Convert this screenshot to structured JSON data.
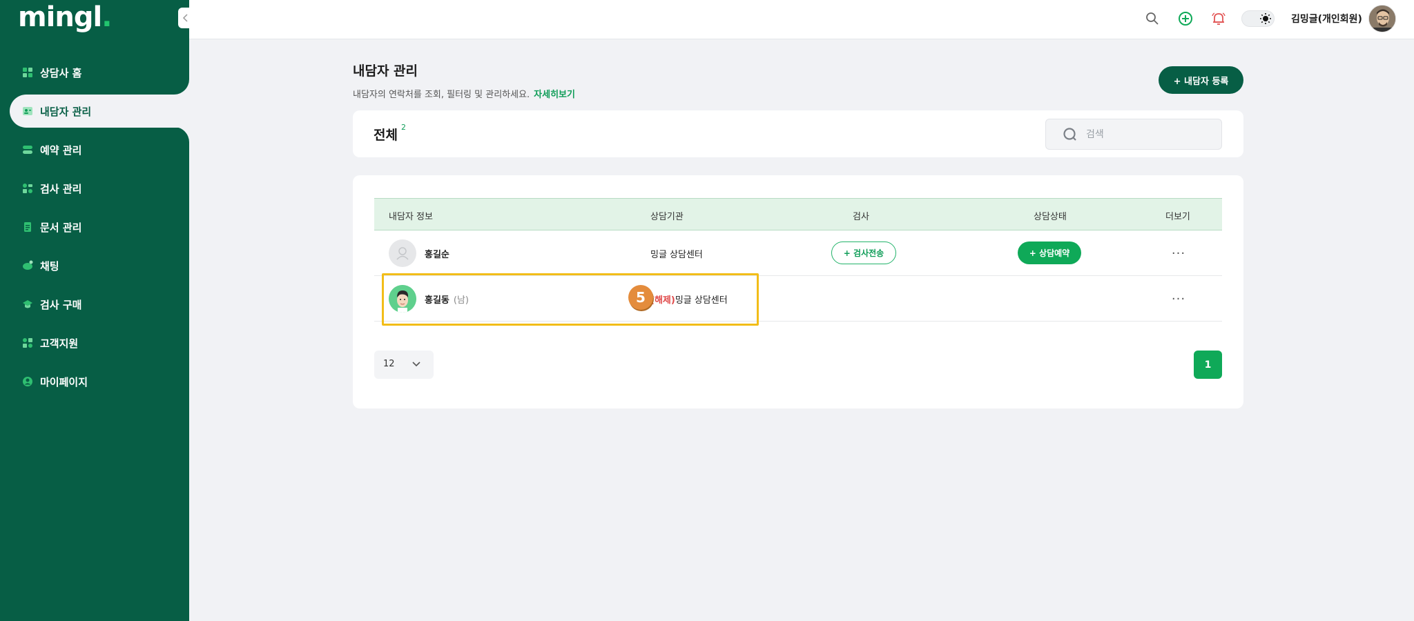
{
  "app": {
    "logo": "mingl",
    "logo_dot": "."
  },
  "sidebar": {
    "items": [
      {
        "label": "상담사 홈",
        "icon": "dashboard-icon"
      },
      {
        "label": "내담자 관리",
        "icon": "client-card-icon",
        "active": true
      },
      {
        "label": "예약 관리",
        "icon": "reservation-icon"
      },
      {
        "label": "검사 관리",
        "icon": "test-icon"
      },
      {
        "label": "문서 관리",
        "icon": "document-icon"
      },
      {
        "label": "채팅",
        "icon": "chat-icon"
      },
      {
        "label": "검사 구매",
        "icon": "purchase-icon"
      },
      {
        "label": "고객지원",
        "icon": "support-icon"
      },
      {
        "label": "마이페이지",
        "icon": "mypage-icon"
      }
    ]
  },
  "header": {
    "user_name": "김밍글(개인회원)",
    "icons": [
      "search-icon",
      "add-circle-icon",
      "bell-icon",
      "theme-toggle",
      "avatar"
    ]
  },
  "page": {
    "title": "내담자 관리",
    "description": "내담자의 연락처를 조회, 필터링 및 관리하세요.",
    "more_link": "자세히보기",
    "add_button": "+  내담자 등록"
  },
  "summary": {
    "label": "전체",
    "count": "2",
    "search_placeholder": "검색"
  },
  "table": {
    "columns": [
      "내담자 정보",
      "상담기관",
      "검사",
      "상담상태",
      "더보기"
    ],
    "rows": [
      {
        "name": "홍길순",
        "gender": "",
        "org_prefix": "",
        "org": "밍글 상담센터",
        "test_button": "+ 검사전송",
        "status_button": "+ 상담예약",
        "more": "···"
      },
      {
        "name": "홍길동",
        "gender": "(남)",
        "org_prefix": "(해제)",
        "org": "밍글 상담센터",
        "test_button": "",
        "status_button": "",
        "more": "···"
      }
    ]
  },
  "pagination": {
    "page_size": "12",
    "current_page": "1"
  },
  "annotation": {
    "step": "5"
  },
  "colors": {
    "sidebar_bg": "#075e45",
    "accent": "#0fa958",
    "highlight": "#f2bd18",
    "badge": "#e48c3c",
    "released": "#e04848"
  }
}
